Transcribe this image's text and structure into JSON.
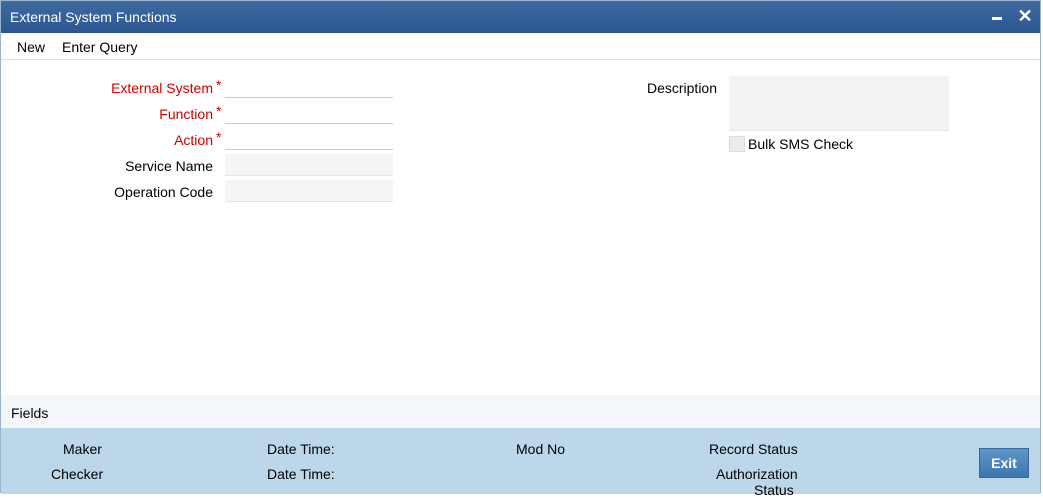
{
  "window": {
    "title": "External System Functions"
  },
  "toolbar": {
    "new_label": "New",
    "enter_query_label": "Enter Query"
  },
  "form": {
    "external_system_label": "External System",
    "function_label": "Function",
    "action_label": "Action",
    "service_name_label": "Service Name",
    "operation_code_label": "Operation Code",
    "description_label": "Description",
    "bulk_sms_label": "Bulk SMS Check",
    "required_marker": "*",
    "external_system_value": "",
    "function_value": "",
    "action_value": "",
    "service_name_value": "",
    "operation_code_value": "",
    "description_value": "",
    "bulk_sms_checked": false
  },
  "fields_tab": {
    "label": "Fields"
  },
  "audit": {
    "maker_label": "Maker",
    "checker_label": "Checker",
    "date_time_label": "Date Time:",
    "mod_no_label": "Mod No",
    "record_status_label": "Record Status",
    "authorization_label": "Authorization",
    "status_label": "Status",
    "exit_label": "Exit"
  },
  "colors": {
    "titlebar": "#2b5691",
    "required": "#cc0000",
    "audit_bg": "#bcd6ea",
    "exit_button": "#3d76b0"
  }
}
